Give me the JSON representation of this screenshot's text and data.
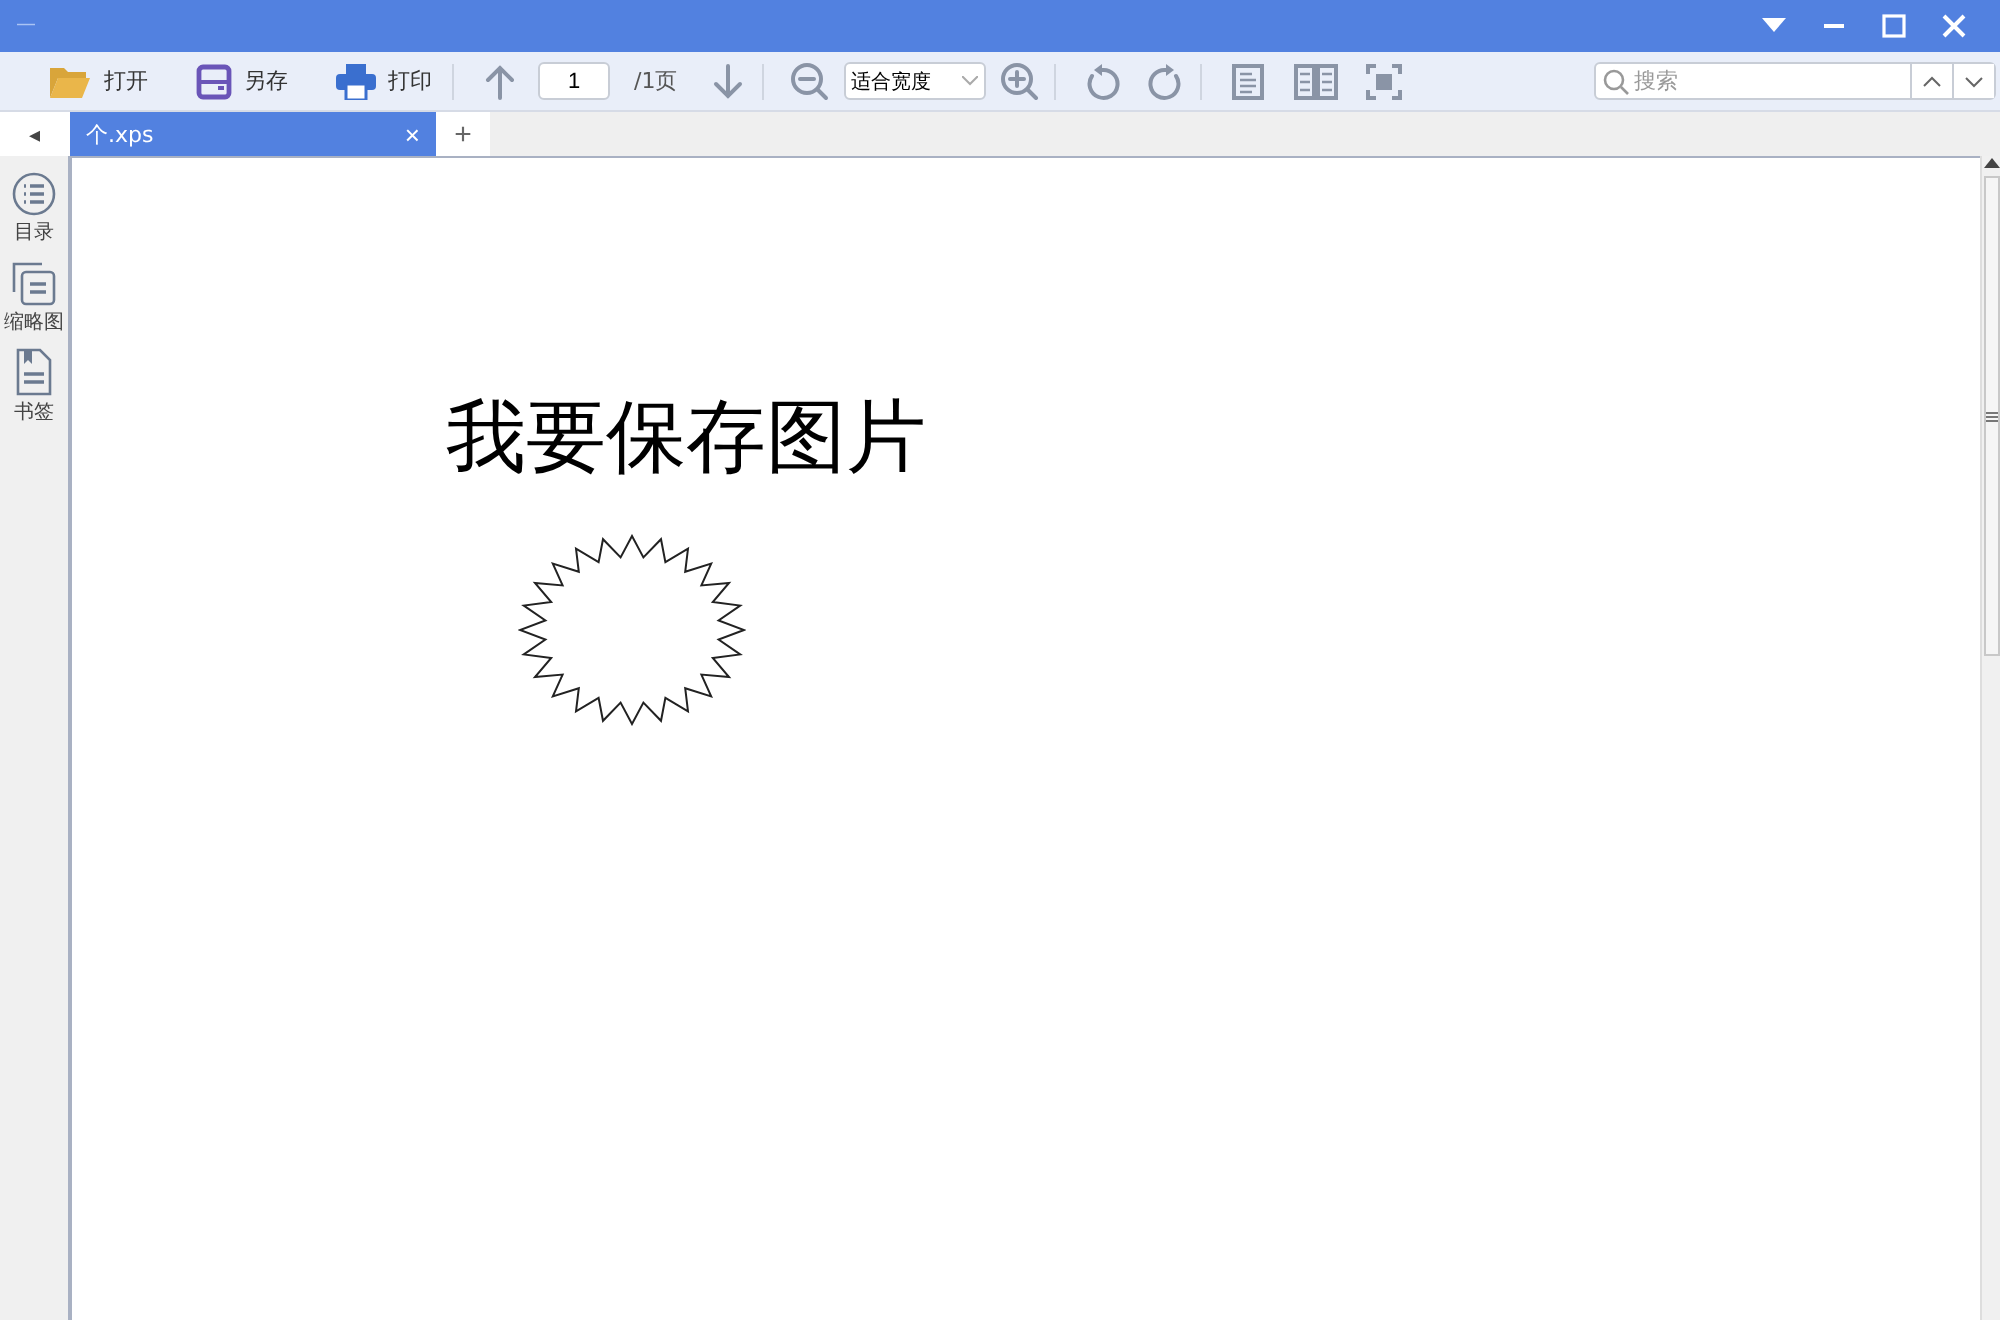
{
  "window": {
    "title": "—"
  },
  "toolbar": {
    "open": "打开",
    "save_as": "另存",
    "print": "打印",
    "page_input": "1",
    "page_total": "/1页",
    "zoom_mode": "适合宽度",
    "search": {
      "placeholder": "搜索"
    }
  },
  "tabs": [
    {
      "label": "个.xps",
      "selected": true,
      "close": "×"
    }
  ],
  "new_tab": "+",
  "sidebar_toggle": "◂",
  "sidebar": {
    "items": [
      {
        "label": "目录",
        "kind": "toc"
      },
      {
        "label": "缩略图",
        "kind": "thumbnails"
      },
      {
        "label": "书签",
        "kind": "bookmarks"
      }
    ]
  },
  "document": {
    "heading": "我要保存图片",
    "shapes": [
      {
        "kind": "starburst"
      }
    ]
  }
}
